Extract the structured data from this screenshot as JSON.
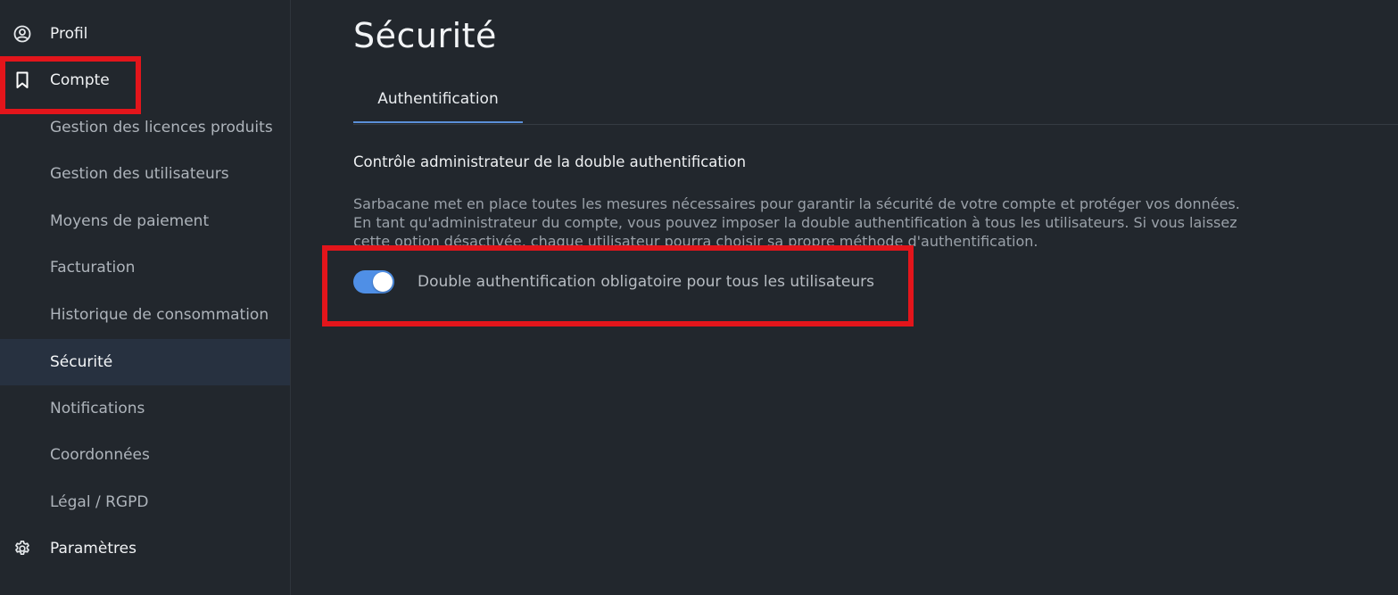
{
  "sidebar": {
    "items": [
      {
        "label": "Profil",
        "icon": "user-circle-icon"
      },
      {
        "label": "Compte",
        "icon": "bookmark-icon"
      },
      {
        "label": "Gestion des licences produits"
      },
      {
        "label": "Gestion des utilisateurs"
      },
      {
        "label": "Moyens de paiement"
      },
      {
        "label": "Facturation"
      },
      {
        "label": "Historique de consommation"
      },
      {
        "label": "Sécurité"
      },
      {
        "label": "Notifications"
      },
      {
        "label": "Coordonnées"
      },
      {
        "label": "Légal / RGPD"
      },
      {
        "label": "Paramètres",
        "icon": "gear-icon"
      }
    ],
    "active_item": "Sécurité"
  },
  "main": {
    "title": "Sécurité",
    "tabs": [
      {
        "label": "Authentification",
        "active": true
      }
    ],
    "section": {
      "title": "Contrôle administrateur de la double authentification",
      "description": "Sarbacane met en place toutes les mesures nécessaires pour garantir la sécurité de votre compte et protéger vos données. En tant qu'administrateur du compte, vous pouvez imposer la double authentification à tous les utilisateurs. Si vous laissez cette option désactivée, chaque utilisateur pourra choisir sa propre méthode d'authentification.",
      "toggle": {
        "label": "Double authentification obligatoire pour tous les utilisateurs",
        "enabled": true
      }
    }
  },
  "colors": {
    "background": "#22272d",
    "active_nav": "#273140",
    "accent": "#4f8fe6",
    "highlight": "#e3151b"
  }
}
